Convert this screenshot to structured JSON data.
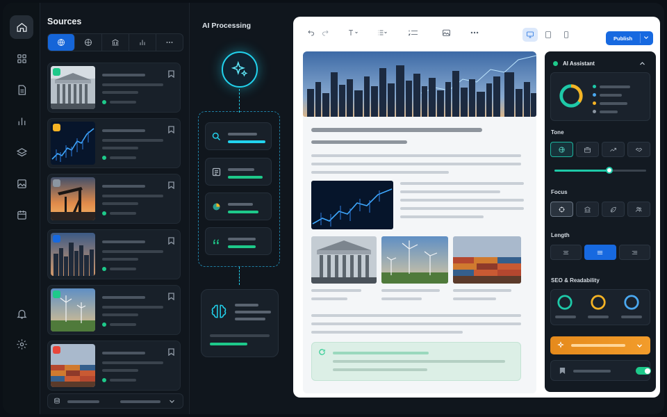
{
  "colors": {
    "accent_blue": "#1769e0",
    "accent_cyan": "#22d3ee",
    "accent_green": "#1ec98a",
    "accent_orange": "#f29c2b"
  },
  "rail": {
    "items": [
      {
        "icon": "home-icon"
      },
      {
        "icon": "grid-icon"
      },
      {
        "icon": "document-icon"
      },
      {
        "icon": "bar-chart-icon"
      },
      {
        "icon": "layers-icon"
      },
      {
        "icon": "image-icon"
      },
      {
        "icon": "calendar-icon"
      },
      {
        "icon": "bell-icon"
      },
      {
        "icon": "gear-icon"
      }
    ]
  },
  "sources": {
    "title": "Sources",
    "tabs": [
      {
        "icon": "globe-icon",
        "active": true
      },
      {
        "icon": "web-icon"
      },
      {
        "icon": "institution-icon"
      },
      {
        "icon": "bar-chart-icon"
      },
      {
        "icon": "more-icon"
      }
    ],
    "cards": [
      {
        "image": "classical-building",
        "badge_color": "#1ec98a"
      },
      {
        "image": "financial-chart",
        "badge_color": "#f5b324"
      },
      {
        "image": "oil-pump",
        "badge_color": "#8b95a1"
      },
      {
        "image": "city-skyline",
        "badge_color": "#1769e0"
      },
      {
        "image": "wind-turbines",
        "badge_color": "#1ec98a"
      },
      {
        "image": "shipping-containers",
        "badge_color": "#e8463b"
      }
    ]
  },
  "processing": {
    "title": "AI Processing",
    "steps": [
      {
        "icon": "search-icon",
        "bar_color": "#22d3ee",
        "progress": 0.9
      },
      {
        "icon": "list-icon",
        "bar_color": "#1ec98a",
        "progress": 0.85
      },
      {
        "icon": "pie-chart-icon",
        "bar_color": "#1ec98a",
        "progress": 0.75
      },
      {
        "icon": "quote-icon",
        "bar_color": "#1ec98a",
        "progress": 0.7
      }
    ],
    "output": {
      "icon": "brain-icon",
      "progress": 0.6
    }
  },
  "editor": {
    "toolbar": [
      "undo-icon",
      "redo-icon",
      "text-format-icon",
      "list-icon",
      "numbered-list-icon",
      "image-icon",
      "more-icon"
    ],
    "views": [
      {
        "icon": "desktop-icon",
        "active": true
      },
      {
        "icon": "tablet-icon"
      },
      {
        "icon": "mobile-icon"
      }
    ],
    "publish_label": "Publish"
  },
  "assistant": {
    "title": "AI Assistant",
    "tone_label": "Tone",
    "tone_value": 0.6,
    "focus_label": "Focus",
    "length_label": "Length",
    "seo_label": "SEO & Readability",
    "seo_ring_colors": [
      "#1ec9a8",
      "#f5b324",
      "#4aa8f0"
    ]
  }
}
